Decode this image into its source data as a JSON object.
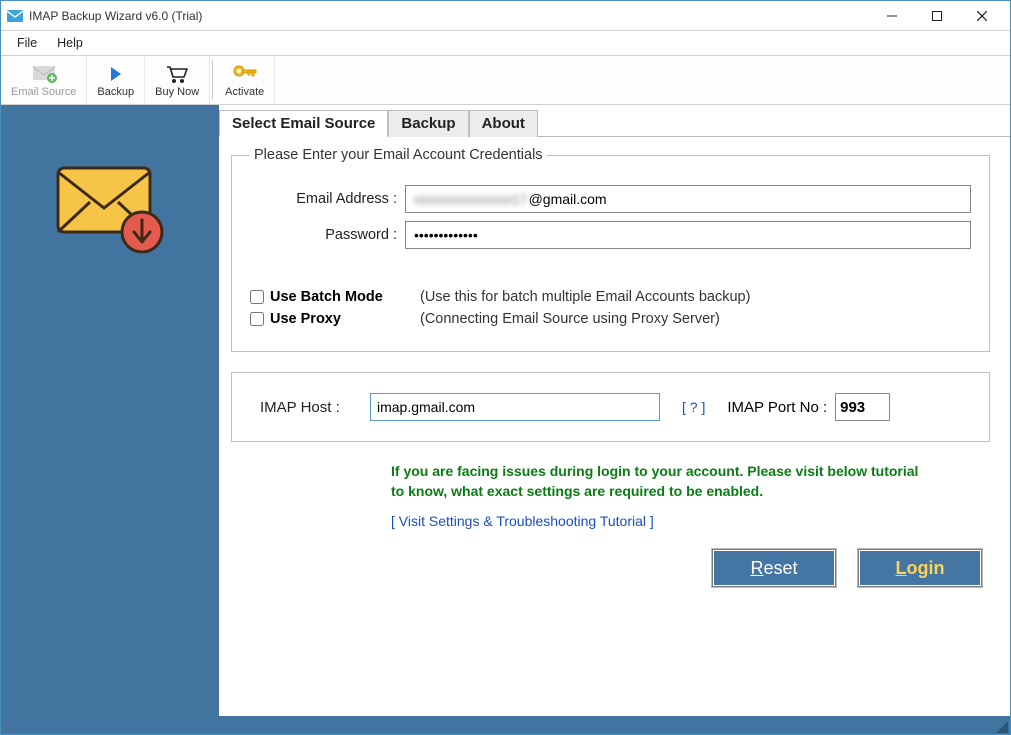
{
  "window": {
    "title": "IMAP Backup Wizard v6.0 (Trial)"
  },
  "menubar": {
    "file": "File",
    "help": "Help"
  },
  "toolbar": {
    "email_source": "Email Source",
    "backup": "Backup",
    "buy_now": "Buy Now",
    "activate": "Activate"
  },
  "tabs": {
    "select_email_source": "Select Email Source",
    "backup": "Backup",
    "about": "About"
  },
  "credentials": {
    "legend": "Please Enter your Email Account Credentials",
    "email_label": "Email Address :",
    "email_suffix": "@gmail.com",
    "email_masked_prefix": "xxxxxxxxxxxxxx17",
    "password_label": "Password :",
    "password_value": "•••••••••••••",
    "batch_label": "Use Batch Mode",
    "batch_desc": "(Use this for batch multiple Email Accounts backup)",
    "proxy_label": "Use Proxy",
    "proxy_desc": "(Connecting Email Source using Proxy Server)"
  },
  "imap": {
    "host_label": "IMAP Host :",
    "host_value": "imap.gmail.com",
    "help_link": "[ ? ]",
    "port_label": "IMAP Port No :",
    "port_value": "993"
  },
  "notice": "If you are facing issues during login to your account. Please visit below tutorial to know, what exact settings are required to be enabled.",
  "tutorial_link": "[ Visit Settings & Troubleshooting Tutorial ]",
  "buttons": {
    "reset_prefix": "R",
    "reset_rest": "eset",
    "login_prefix": "L",
    "login_rest": "ogin"
  }
}
